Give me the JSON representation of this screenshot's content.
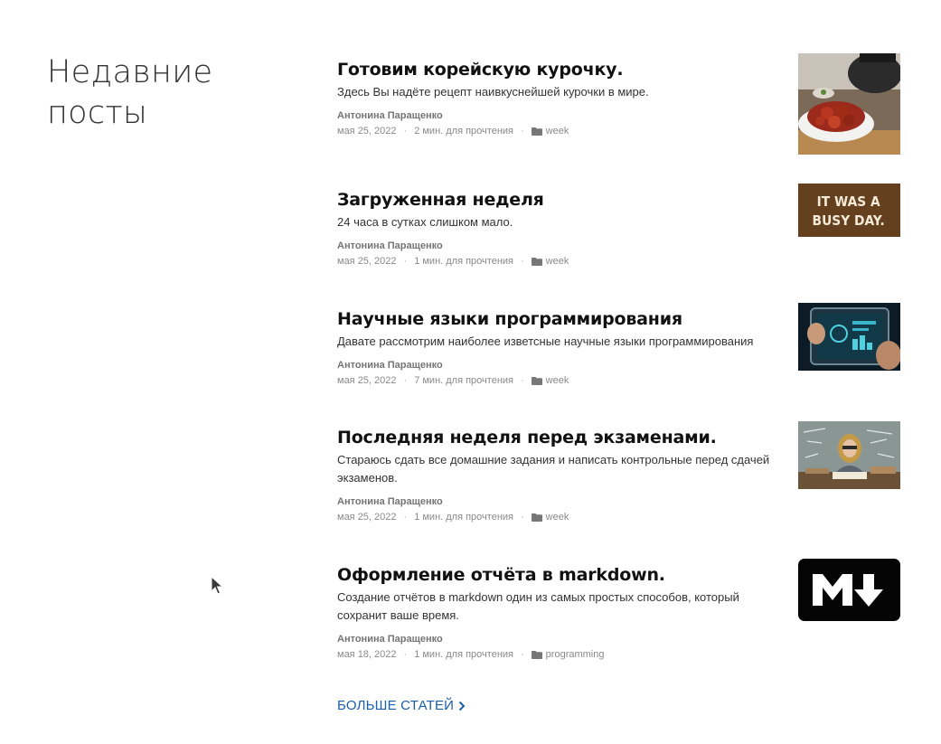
{
  "section_title": "Недавние посты",
  "posts": [
    {
      "title": "Готовим корейскую курочку.",
      "description": "Здесь Вы надёте рецепт наивкуснейшей курочки в мире.",
      "author": "Антонина Паращенко",
      "date": "мая 25, 2022",
      "read_time": "2 мин. для прочтения",
      "category": "week",
      "thumbnail": "korean-chicken-photo"
    },
    {
      "title": "Загруженная неделя",
      "description": "24 часа в сутках слишком мало.",
      "author": "Антонина Паращенко",
      "date": "мая 25, 2022",
      "read_time": "1 мин. для прочтения",
      "category": "week",
      "thumbnail": "busy-day-sign",
      "thumbnail_text_1": "IT WAS A",
      "thumbnail_text_2": "BUSY DAY."
    },
    {
      "title": "Научные языки программирования",
      "description": "Давате рассмотрим наиболее изветсные научные языки программирования",
      "author": "Антонина Паращенко",
      "date": "мая 25, 2022",
      "read_time": "7 мин. для прочтения",
      "category": "week",
      "thumbnail": "tablet-data-photo"
    },
    {
      "title": "Последняя неделя перед экзаменами.",
      "description": "Стараюсь сдать все домашние задания и написать контрольные перед сдачей экзаменов.",
      "author": "Антонина Паращенко",
      "date": "мая 25, 2022",
      "read_time": "1 мин. для прочтения",
      "category": "week",
      "thumbnail": "student-with-books-photo"
    },
    {
      "title": "Оформление отчёта в markdown.",
      "description": "Создание отчётов в markdown один из самых простых способов, который сохранит ваше время.",
      "author": "Антонина Паращенко",
      "date": "мая 18, 2022",
      "read_time": "1 мин. для прочтения",
      "category": "programming",
      "thumbnail": "markdown-logo"
    }
  ],
  "separator": "·",
  "more_link": "БОЛЬШЕ СТАТЕЙ",
  "colors": {
    "link": "#1a5fa8",
    "title": "#111111",
    "meta": "#8a8a8a"
  }
}
